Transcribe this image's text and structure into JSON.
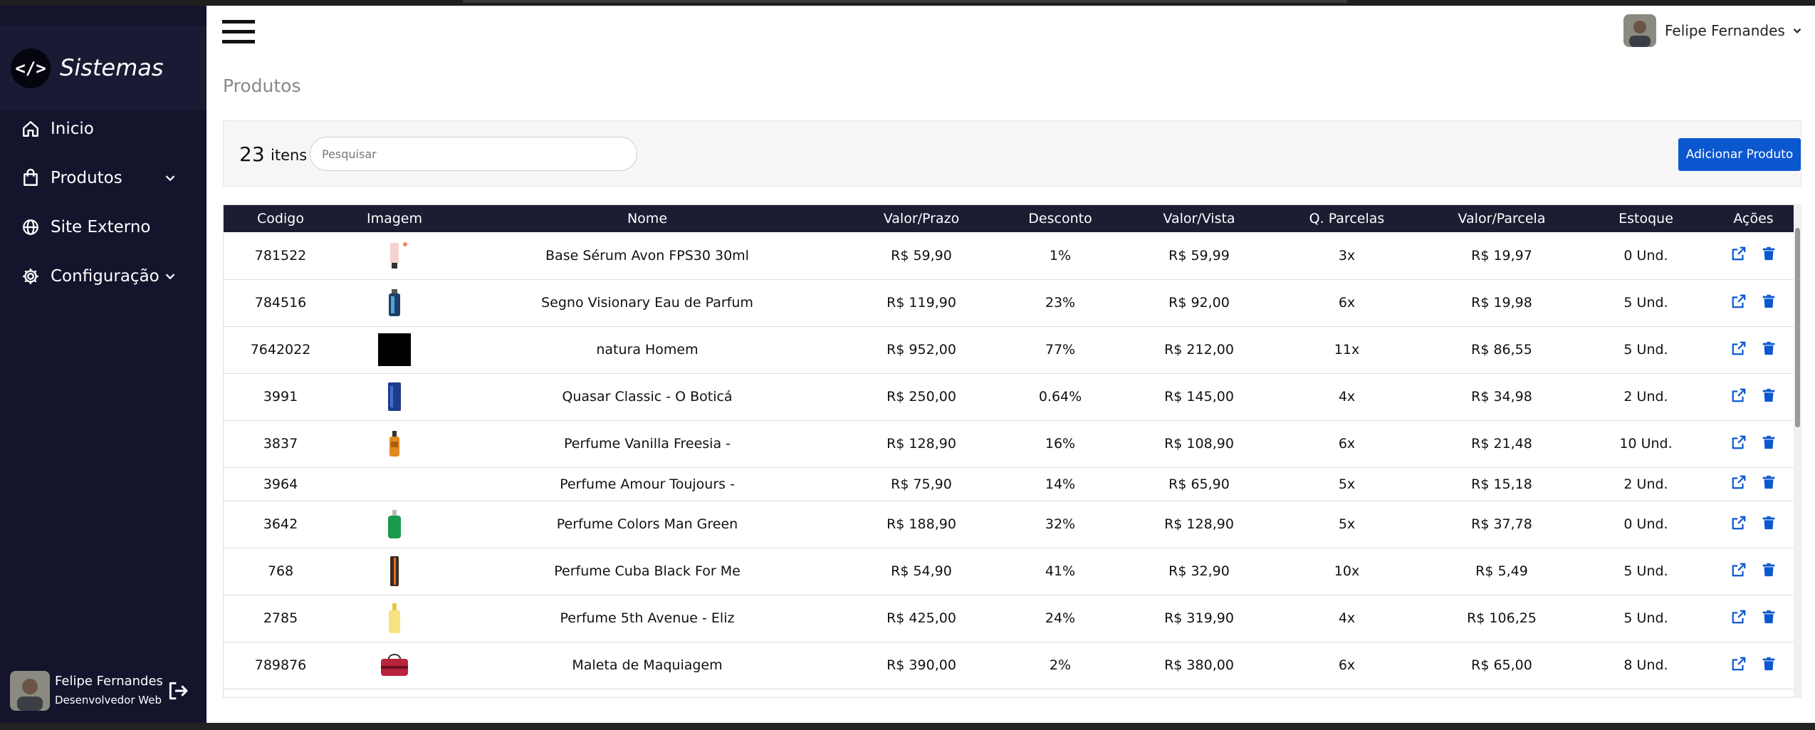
{
  "sidebar": {
    "brand": "Sistemas",
    "brand_logo_text": "</>",
    "items": [
      {
        "label": "Inicio",
        "icon": "home-icon"
      },
      {
        "label": "Produtos",
        "icon": "bag-icon"
      },
      {
        "label": "Site Externo",
        "icon": "globe-icon"
      },
      {
        "label": "Configuração",
        "icon": "gear-icon"
      }
    ],
    "user": {
      "name": "Felipe Fernandes",
      "role": "Desenvolvedor Web"
    }
  },
  "header": {
    "user_name": "Felipe Fernandes"
  },
  "page": {
    "title": "Produtos"
  },
  "toolbar": {
    "count": "23",
    "count_label": "itens",
    "search_placeholder": "Pesquisar",
    "add_label": "Adicionar Produto"
  },
  "table": {
    "columns": [
      "Codigo",
      "Imagem",
      "Nome",
      "Valor/Prazo",
      "Desconto",
      "Valor/Vista",
      "Q. Parcelas",
      "Valor/Parcela",
      "Estoque",
      "Ações"
    ],
    "rows": [
      {
        "codigo": "781522",
        "nome": "Base Sérum Avon FPS30 30ml",
        "valor_prazo": "R$ 59,90",
        "desconto": "1%",
        "valor_vista": "R$ 59,99",
        "parcelas": "3x",
        "valor_parcela": "R$ 19,97",
        "estoque": "0 Und.",
        "img": "tube"
      },
      {
        "codigo": "784516",
        "nome": "Segno Visionary Eau de Parfum",
        "valor_prazo": "R$ 119,90",
        "desconto": "23%",
        "valor_vista": "R$ 92,00",
        "parcelas": "6x",
        "valor_parcela": "R$ 19,98",
        "estoque": "5 Und.",
        "img": "blue-bottle"
      },
      {
        "codigo": "7642022",
        "nome": "natura Homem",
        "valor_prazo": "R$ 952,00",
        "desconto": "77%",
        "valor_vista": "R$ 212,00",
        "parcelas": "11x",
        "valor_parcela": "R$ 86,55",
        "estoque": "5 Und.",
        "img": "black"
      },
      {
        "codigo": "3991",
        "nome": "Quasar Classic - O Boticá",
        "valor_prazo": "R$ 250,00",
        "desconto": "0.64%",
        "valor_vista": "R$ 145,00",
        "parcelas": "4x",
        "valor_parcela": "R$ 34,98",
        "estoque": "2 Und.",
        "img": "navy-bottle"
      },
      {
        "codigo": "3837",
        "nome": "Perfume Vanilla Freesia -",
        "valor_prazo": "R$ 128,90",
        "desconto": "16%",
        "valor_vista": "R$ 108,90",
        "parcelas": "6x",
        "valor_parcela": "R$ 21,48",
        "estoque": "10 Und.",
        "img": "amber-bottle"
      },
      {
        "codigo": "3964",
        "nome": "Perfume Amour Toujours -",
        "valor_prazo": "R$ 75,90",
        "desconto": "14%",
        "valor_vista": "R$ 65,90",
        "parcelas": "5x",
        "valor_parcela": "R$ 15,18",
        "estoque": "2 Und.",
        "img": "none"
      },
      {
        "codigo": "3642",
        "nome": "Perfume Colors Man Green",
        "valor_prazo": "R$ 188,90",
        "desconto": "32%",
        "valor_vista": "R$ 128,90",
        "parcelas": "5x",
        "valor_parcela": "R$ 37,78",
        "estoque": "0 Und.",
        "img": "green-bottle"
      },
      {
        "codigo": "768",
        "nome": "Perfume Cuba Black For Me",
        "valor_prazo": "R$ 54,90",
        "desconto": "41%",
        "valor_vista": "R$ 32,90",
        "parcelas": "10x",
        "valor_parcela": "R$ 5,49",
        "estoque": "5 Und.",
        "img": "tall-bottle"
      },
      {
        "codigo": "2785",
        "nome": "Perfume 5th Avenue - Eliz",
        "valor_prazo": "R$ 425,00",
        "desconto": "24%",
        "valor_vista": "R$ 319,90",
        "parcelas": "4x",
        "valor_parcela": "R$ 106,25",
        "estoque": "5 Und.",
        "img": "gold-bottle"
      },
      {
        "codigo": "789876",
        "nome": "Maleta de Maquiagem",
        "valor_prazo": "R$ 390,00",
        "desconto": "2%",
        "valor_vista": "R$ 380,00",
        "parcelas": "6x",
        "valor_parcela": "R$ 65,00",
        "estoque": "8 Und.",
        "img": "case"
      }
    ]
  },
  "colors": {
    "sidebar_bg": "#14142d",
    "header_bg": "#1c1c33",
    "accent": "#0b57d0"
  }
}
